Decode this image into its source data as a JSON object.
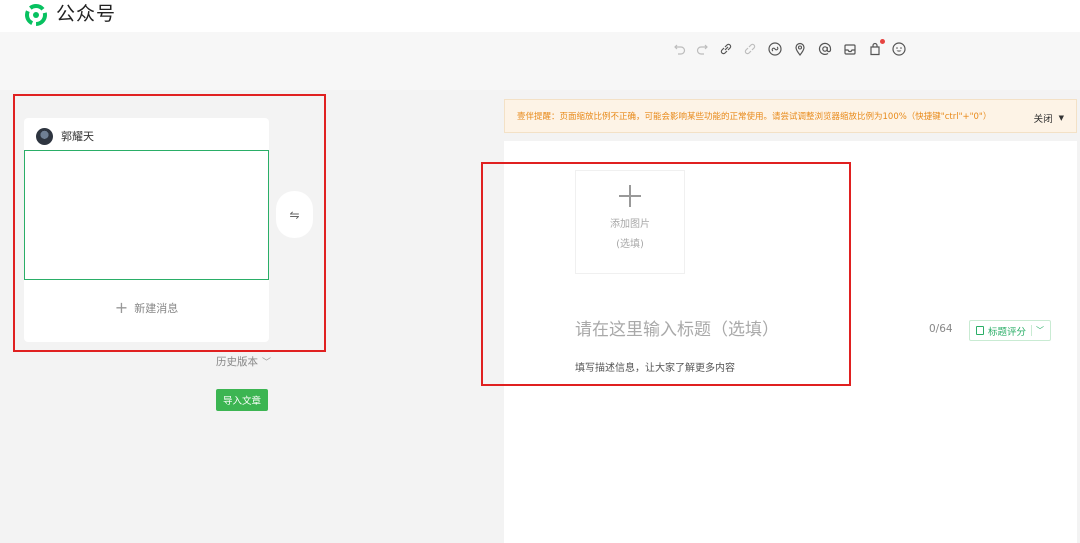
{
  "app": {
    "title": "公众号"
  },
  "toolbar": {
    "icons": [
      "undo-icon",
      "redo-icon",
      "link-icon",
      "unlink-icon",
      "mini-program-icon",
      "location-icon",
      "mention-icon",
      "inbox-icon",
      "product-icon",
      "emoji-icon"
    ]
  },
  "left": {
    "card": {
      "author": "郭耀天",
      "new_label": "新建消息"
    },
    "swap_symbol": "⇋",
    "history_label": "历史版本",
    "history_chevron": "﹀",
    "import_label": "导入文章"
  },
  "right": {
    "notice": {
      "text": "壹伴提醒：页面缩放比例不正确，可能会影响某些功能的正常使用。请尝试调整浏览器缩放比例为100%（快捷键\"ctrl\"+\"0\"）",
      "close_label": "关闭",
      "close_caret": "▼"
    },
    "add_image": {
      "line1": "添加图片",
      "line2": "(选填)"
    },
    "title_placeholder": "请在这里输入标题（选填）",
    "title_count": "0/64",
    "score_label": "标题评分",
    "score_chevron": "﹀",
    "desc_placeholder": "填写描述信息，让大家了解更多内容"
  },
  "colors": {
    "brand": "#07c160",
    "import_button": "#3cb552",
    "annotation_red": "#e02020",
    "notice_text": "#e88a1a"
  }
}
